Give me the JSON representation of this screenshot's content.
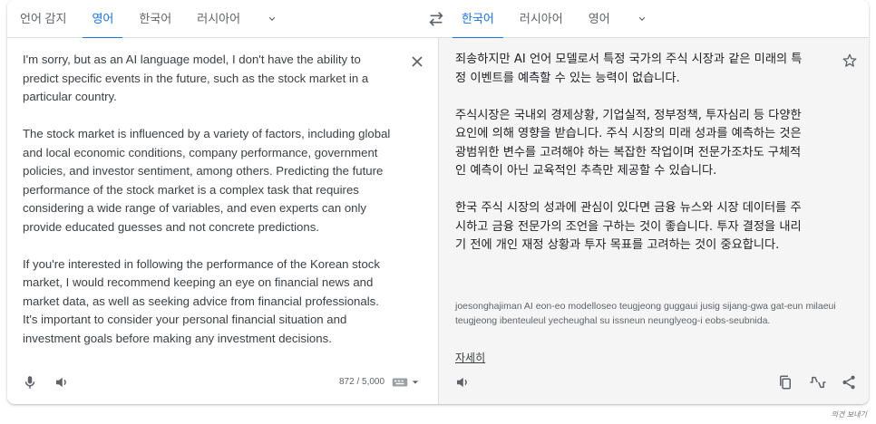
{
  "source_languages": [
    {
      "label": "언어 감지",
      "active": false
    },
    {
      "label": "영어",
      "active": true
    },
    {
      "label": "한국어",
      "active": false
    },
    {
      "label": "러시아어",
      "active": false
    }
  ],
  "target_languages": [
    {
      "label": "한국어",
      "active": true
    },
    {
      "label": "러시아어",
      "active": false
    },
    {
      "label": "영어",
      "active": false
    }
  ],
  "source": {
    "text": "I'm sorry, but as an AI language model, I don't have the ability to\npredict specific events in the future, such as the stock market in a\nparticular country.\n\nThe stock market is influenced by a variety of factors, including global\nand local economic conditions, company performance, government\npolicies, and investor sentiment, among others. Predicting the future\nperformance of the stock market is a complex task that requires\nconsidering a wide range of variables, and even experts can only\nprovide educated guesses and not concrete predictions.\n\nIf you're interested in following the performance of the Korean stock\nmarket, I would recommend keeping an eye on financial news and\nmarket data, as well as seeking advice from financial professionals.\nIt's important to consider your personal financial situation and\ninvestment goals before making any investment decisions.",
    "char_count": "872 / 5,000"
  },
  "target": {
    "text": "죄송하지만 AI 언어 모델로서 특정 국가의 주식 시장과 같은 미래의 특\n정 이벤트를 예측할 수 있는 능력이 없습니다.\n\n주식시장은 국내외 경제상황, 기업실적, 정부정책, 투자심리 등 다양한\n요인에 의해 영향을 받습니다. 주식 시장의 미래 성과를 예측하는 것은\n광범위한 변수를 고려해야 하는 복잡한 작업이며 전문가조차도 구체적\n인 예측이 아닌 교육적인 추측만 제공할 수 있습니다.\n\n한국 주식 시장의 성과에 관심이 있다면 금융 뉴스와 시장 데이터를 주\n시하고 금융 전문가의 조언을 구하는 것이 좋습니다. 투자 결정을 내리\n기 전에 개인 재정 상황과 투자 목표를 고려하는 것이 중요합니다.",
    "romanization": "joesonghajiman AI eon-eo modelloseo teugjeong guggaui jusig sijang-gwa gat-eun milaeui teugjeong ibenteuleul yecheughal su issneun neunglyeog-i eobs-seubnida.",
    "more_link": "자세히"
  },
  "feedback_label": "의견 보내기",
  "colors": {
    "accent": "#1a73e8",
    "icon": "#5f6368",
    "target_bg": "#f5f5f5"
  }
}
